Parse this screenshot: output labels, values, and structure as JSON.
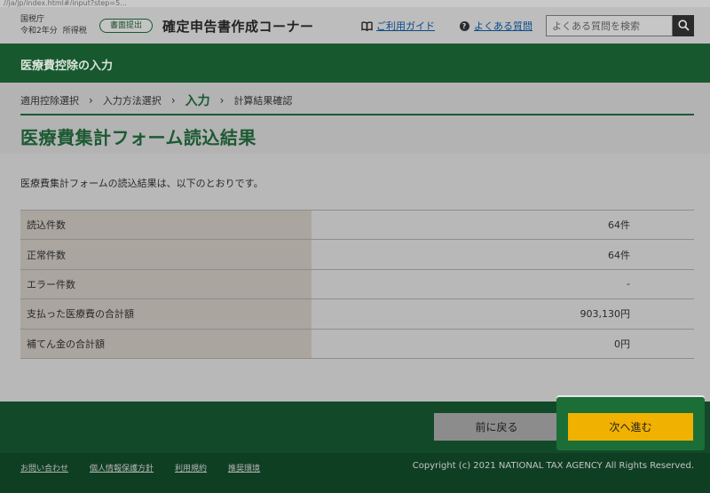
{
  "browser": {
    "url_fragment": "//ja/jp/index.html#/input?step=5..."
  },
  "header": {
    "agency": "国税庁",
    "year": "令和2年分",
    "tax_type": "所得税",
    "badge": "書面提出",
    "site_title": "確定申告書作成コーナー",
    "guide_link": "ご利用ガイド",
    "faq_link": "よくある質問",
    "search_placeholder": "よくある質問を検索"
  },
  "section": {
    "title": "医療費控除の入力"
  },
  "breadcrumb": {
    "steps": [
      "適用控除選択",
      "入力方法選択",
      "入力",
      "計算結果確認"
    ],
    "current_index": 2
  },
  "page": {
    "title": "医療費集計フォーム読込結果",
    "intro": "医療費集計フォームの読込結果は、以下のとおりです。"
  },
  "results": [
    {
      "label": "読込件数",
      "value": "64件"
    },
    {
      "label": "正常件数",
      "value": "64件"
    },
    {
      "label": "エラー件数",
      "value": "-"
    },
    {
      "label": "支払った医療費の合計額",
      "value": "903,130円"
    },
    {
      "label": "補てん金の合計額",
      "value": "0円"
    }
  ],
  "actions": {
    "back_label": "前に戻る",
    "next_label": "次へ進む"
  },
  "footer": {
    "links": [
      "お問い合わせ",
      "個人情報保護方針",
      "利用規約",
      "推奨環境"
    ],
    "copyright": "Copyright (c) 2021 NATIONAL TAX AGENCY All Rights Reserved."
  },
  "colors": {
    "brand_green": "#18582f",
    "next_button": "#f1b100",
    "footer": "#0f3f23"
  }
}
